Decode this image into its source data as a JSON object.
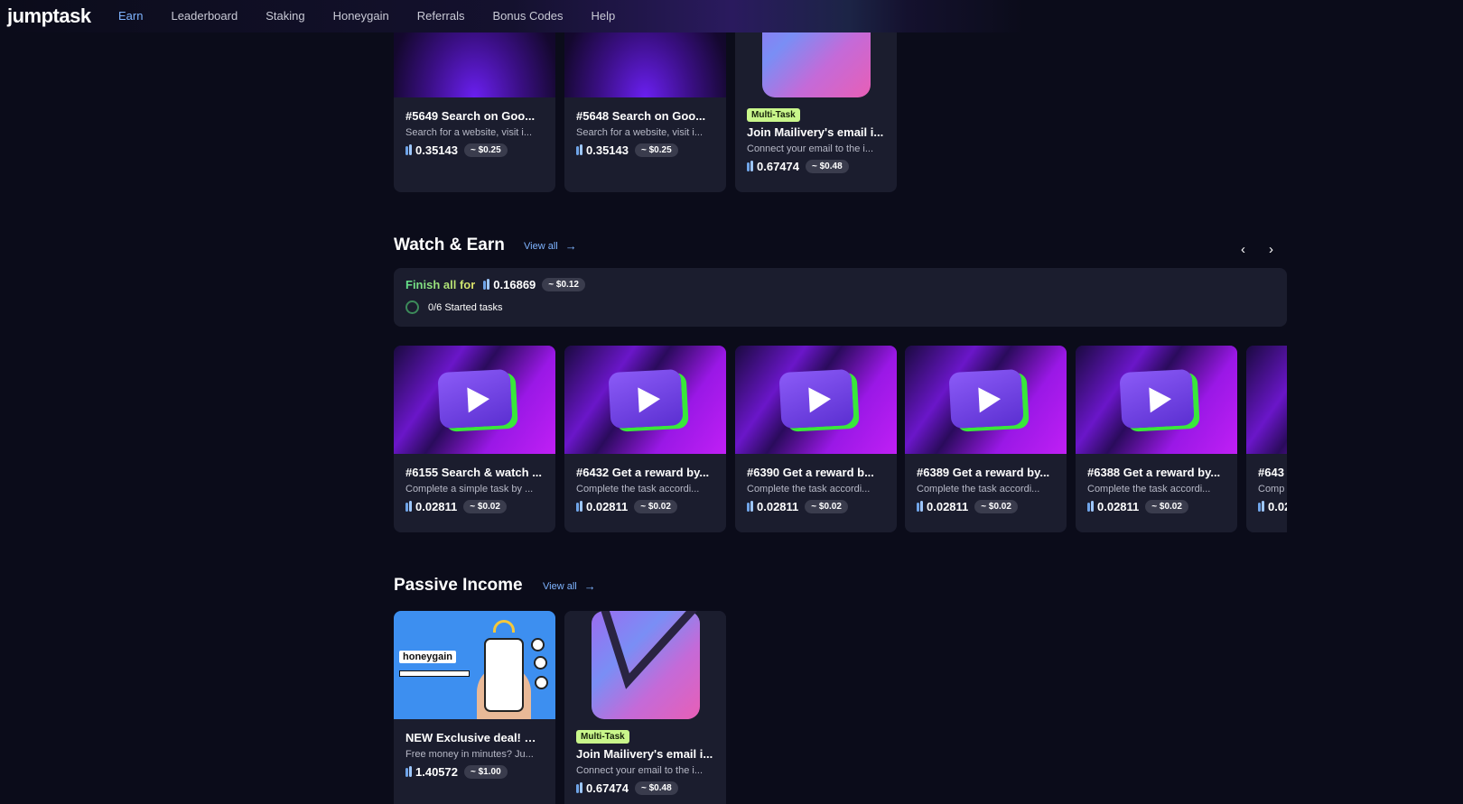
{
  "nav": {
    "logo": "jumptask",
    "items": [
      "Earn",
      "Leaderboard",
      "Staking",
      "Honeygain",
      "Referrals",
      "Bonus Codes",
      "Help"
    ],
    "active": "Earn"
  },
  "top_cards": [
    {
      "badge": "",
      "title": "#5649 Search on Goo...",
      "desc": "Search for a website, visit i...",
      "amount": "0.35143",
      "usd": "~ $0.25",
      "image": "google-icon"
    },
    {
      "badge": "",
      "title": "#5648 Search on Goo...",
      "desc": "Search for a website, visit i...",
      "amount": "0.35143",
      "usd": "~ $0.25",
      "image": "google-icon"
    },
    {
      "badge": "Multi-Task",
      "title": "Join Mailivery's email i...",
      "desc": "Connect your email to the i...",
      "amount": "0.67474",
      "usd": "~ $0.48",
      "image": "mailivery-icon"
    }
  ],
  "watch_earn": {
    "title": "Watch & Earn",
    "view_all": "View all",
    "finish_label": "Finish all for",
    "finish_amount": "0.16869",
    "finish_usd": "~ $0.12",
    "progress_text": "0/6 Started tasks",
    "prev": "‹",
    "next": "›",
    "cards": [
      {
        "title": "#6155 Search & watch ...",
        "desc": "Complete a simple task by ...",
        "amount": "0.02811",
        "usd": "~ $0.02"
      },
      {
        "title": "#6432 Get a reward by...",
        "desc": "Complete the task accordi...",
        "amount": "0.02811",
        "usd": "~ $0.02"
      },
      {
        "title": "#6390 Get a reward b...",
        "desc": "Complete the task accordi...",
        "amount": "0.02811",
        "usd": "~ $0.02"
      },
      {
        "title": "#6389 Get a reward by...",
        "desc": "Complete the task accordi...",
        "amount": "0.02811",
        "usd": "~ $0.02"
      },
      {
        "title": "#6388 Get a reward by...",
        "desc": "Complete the task accordi...",
        "amount": "0.02811",
        "usd": "~ $0.02"
      },
      {
        "title": "#643",
        "desc": "Comp",
        "amount": "0.02",
        "usd": ""
      }
    ]
  },
  "passive_income": {
    "title": "Passive Income",
    "view_all": "View all",
    "cards": [
      {
        "badge": "",
        "title": "NEW Exclusive deal! Cl...",
        "desc": "Free money in minutes? Ju...",
        "amount": "1.40572",
        "usd": "~ $1.00",
        "image": "honeygain-banner",
        "brand": "honeygain"
      },
      {
        "badge": "Multi-Task",
        "title": "Join Mailivery's email i...",
        "desc": "Connect your email to the i...",
        "amount": "0.67474",
        "usd": "~ $0.48",
        "image": "mailivery-icon"
      }
    ]
  },
  "colors": {
    "background": "#0b0c1a",
    "card": "#1b1d2e",
    "accent": "#7fb4ff",
    "badge": "#c9f68b"
  }
}
